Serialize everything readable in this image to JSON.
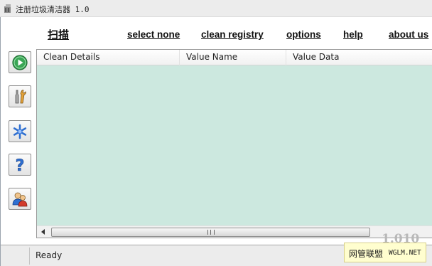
{
  "window": {
    "title": "注册垃圾清洁器 1.0"
  },
  "menu": {
    "scan": "扫描",
    "select_none": "select none",
    "clean_registry": "clean registry",
    "options": "options",
    "help": "help",
    "about_us": "about us"
  },
  "sidebar": {
    "buttons": [
      {
        "icon": "play-icon"
      },
      {
        "icon": "tools-icon"
      },
      {
        "icon": "asterisk-icon"
      },
      {
        "icon": "question-icon"
      },
      {
        "icon": "users-icon"
      }
    ]
  },
  "list": {
    "columns": [
      "Clean Details",
      "Value Name",
      "Value Data"
    ],
    "rows": [],
    "background": "#cce8df"
  },
  "status": {
    "text": "Ready"
  },
  "watermark": {
    "mark": "1.010",
    "badge_cn": "网管联盟",
    "badge_en": "WGLM.NET"
  },
  "colors": {
    "list_background": "#cce8df",
    "play_green": "#3aa655",
    "star_blue": "#2f6fd1",
    "badge_yellow": "#fffecf"
  }
}
